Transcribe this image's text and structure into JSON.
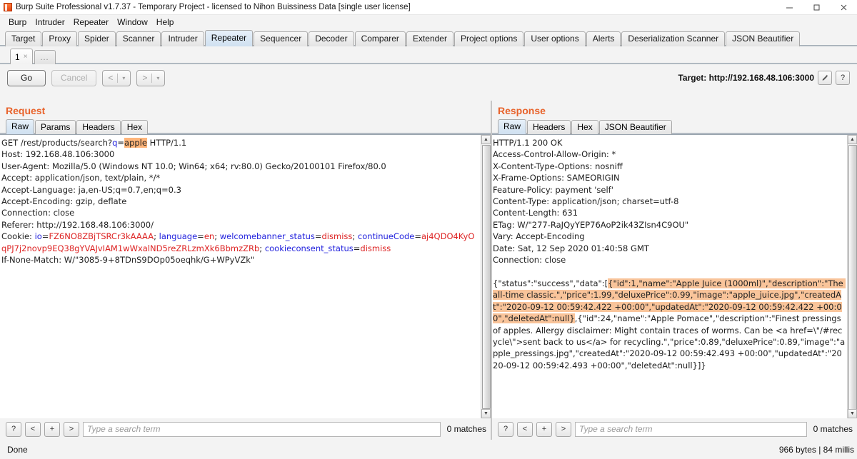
{
  "window": {
    "title": "Burp Suite Professional v1.7.37 - Temporary Project - licensed to Nihon Buissiness Data [single user license]",
    "app_icon": "burp-logo-icon",
    "minimize": "minimize-icon",
    "maximize": "maximize-icon",
    "close": "close-icon"
  },
  "menubar": {
    "items": [
      {
        "label": "Burp"
      },
      {
        "label": "Intruder"
      },
      {
        "label": "Repeater"
      },
      {
        "label": "Window"
      },
      {
        "label": "Help"
      }
    ]
  },
  "main_tabs": {
    "active": "Repeater",
    "items": [
      {
        "label": "Target"
      },
      {
        "label": "Proxy"
      },
      {
        "label": "Spider"
      },
      {
        "label": "Scanner"
      },
      {
        "label": "Intruder"
      },
      {
        "label": "Repeater"
      },
      {
        "label": "Sequencer"
      },
      {
        "label": "Decoder"
      },
      {
        "label": "Comparer"
      },
      {
        "label": "Extender"
      },
      {
        "label": "Project options"
      },
      {
        "label": "User options"
      },
      {
        "label": "Alerts"
      },
      {
        "label": "Deserialization Scanner"
      },
      {
        "label": "JSON Beautifier"
      }
    ]
  },
  "repeater_tabs": {
    "active": "1",
    "items": [
      {
        "label": "1",
        "close": "×"
      }
    ],
    "add_label": "..."
  },
  "toolbar": {
    "go_label": "Go",
    "cancel_label": "Cancel",
    "back_label": "<",
    "forward_label": ">",
    "caret": "▾",
    "target_label": "Target: http://192.168.48.106:3000",
    "edit_icon": "pencil-icon",
    "help_icon": "question-mark-icon",
    "help_label": "?"
  },
  "request": {
    "title": "Request",
    "tabs": [
      {
        "label": "Raw"
      },
      {
        "label": "Params"
      },
      {
        "label": "Headers"
      },
      {
        "label": "Hex"
      }
    ],
    "active_tab": "Raw",
    "lines": [
      [
        {
          "t": "GET /rest/products/search?"
        },
        {
          "t": "q",
          "c": "blue"
        },
        {
          "t": "="
        },
        {
          "t": "apple",
          "c": "hl"
        },
        {
          "t": " HTTP/1.1"
        }
      ],
      [
        {
          "t": "Host: 192.168.48.106:3000"
        }
      ],
      [
        {
          "t": "User-Agent: Mozilla/5.0 (Windows NT 10.0; Win64; x64; rv:80.0) Gecko/20100101 Firefox/80.0"
        }
      ],
      [
        {
          "t": "Accept: application/json, text/plain, */*"
        }
      ],
      [
        {
          "t": "Accept-Language: ja,en-US;q=0.7,en;q=0.3"
        }
      ],
      [
        {
          "t": "Accept-Encoding: gzip, deflate"
        }
      ],
      [
        {
          "t": "Connection: close"
        }
      ],
      [
        {
          "t": "Referer: http://192.168.48.106:3000/"
        }
      ],
      [
        {
          "t": "Cookie: "
        },
        {
          "t": "io",
          "c": "blue"
        },
        {
          "t": "="
        },
        {
          "t": "FZ6NO8ZBjTSRCr3kAAAA",
          "c": "red"
        },
        {
          "t": "; "
        },
        {
          "t": "language",
          "c": "blue"
        },
        {
          "t": "="
        },
        {
          "t": "en",
          "c": "red"
        },
        {
          "t": "; "
        },
        {
          "t": "welcomebanner_status",
          "c": "blue"
        },
        {
          "t": "="
        },
        {
          "t": "dismiss",
          "c": "red"
        },
        {
          "t": "; "
        },
        {
          "t": "continueCode",
          "c": "blue"
        },
        {
          "t": "="
        },
        {
          "t": "aj4QDO4KyOqPJ7j2novp9EQ38gYVAJvIAM1wWxalND5reZRLzmXk6BbmzZRb",
          "c": "red"
        },
        {
          "t": "; "
        },
        {
          "t": "cookieconsent_status",
          "c": "blue"
        },
        {
          "t": "="
        },
        {
          "t": "dismiss",
          "c": "red"
        }
      ],
      [
        {
          "t": "If-None-Match: W/\"3085-9+8TDnS9DOp05oeqhk/G+WPyVZk\""
        }
      ]
    ],
    "search": {
      "help_label": "?",
      "prev_label": "<",
      "add_label": "+",
      "next_label": ">",
      "placeholder": "Type a search term",
      "value": "",
      "matches": "0 matches"
    }
  },
  "response": {
    "title": "Response",
    "tabs": [
      {
        "label": "Raw"
      },
      {
        "label": "Headers"
      },
      {
        "label": "Hex"
      },
      {
        "label": "JSON Beautifier"
      }
    ],
    "active_tab": "Raw",
    "header_lines": [
      "HTTP/1.1 200 OK",
      "Access-Control-Allow-Origin: *",
      "X-Content-Type-Options: nosniff",
      "X-Frame-Options: SAMEORIGIN",
      "Feature-Policy: payment 'self'",
      "Content-Type: application/json; charset=utf-8",
      "Content-Length: 631",
      "ETag: W/\"277-RaJQyYEP76AoP2ik43ZIsn4C9OU\"",
      "Vary: Accept-Encoding",
      "Date: Sat, 12 Sep 2020 01:40:58 GMT",
      "Connection: close"
    ],
    "body_parts": [
      {
        "t": "{\"status\":\"success\",\"data\":["
      },
      {
        "t": "{\"id\":1,\"name\":\"Apple Juice (1000ml)\",\"description\":\"The all-time classic.\",\"price\":1.99,\"deluxePrice\":0.99,\"image\":\"apple_juice.jpg\",\"createdAt\":\"2020-09-12 00:59:42.422 +00:00\",\"updatedAt\":\"2020-09-12 00:59:42.422 +00:00\",\"deletedAt\":null}",
        "c": "hl"
      },
      {
        "t": ",{\"id\":24,\"name\":\"Apple Pomace\",\"description\":\"Finest pressings of apples. Allergy disclaimer: Might contain traces of worms. Can be <a href=\\\"/#recycle\\\">sent back to us</a> for recycling.\",\"price\":0.89,\"deluxePrice\":0.89,\"image\":\"apple_pressings.jpg\",\"createdAt\":\"2020-09-12 00:59:42.493 +00:00\",\"updatedAt\":\"2020-09-12 00:59:42.493 +00:00\",\"deletedAt\":null}]}"
      }
    ],
    "search": {
      "help_label": "?",
      "prev_label": "<",
      "add_label": "+",
      "next_label": ">",
      "placeholder": "Type a search term",
      "value": "",
      "matches": "0 matches"
    }
  },
  "statusbar": {
    "left": "Done",
    "right": "966 bytes | 84 millis"
  },
  "colors": {
    "accent_orange": "#e8622a",
    "highlight": "#f9c49a",
    "match_highlight": "#ffb57a",
    "tab_active": "#cfe0f0",
    "cookie_name": "#2222dd",
    "cookie_value": "#dd2222"
  }
}
